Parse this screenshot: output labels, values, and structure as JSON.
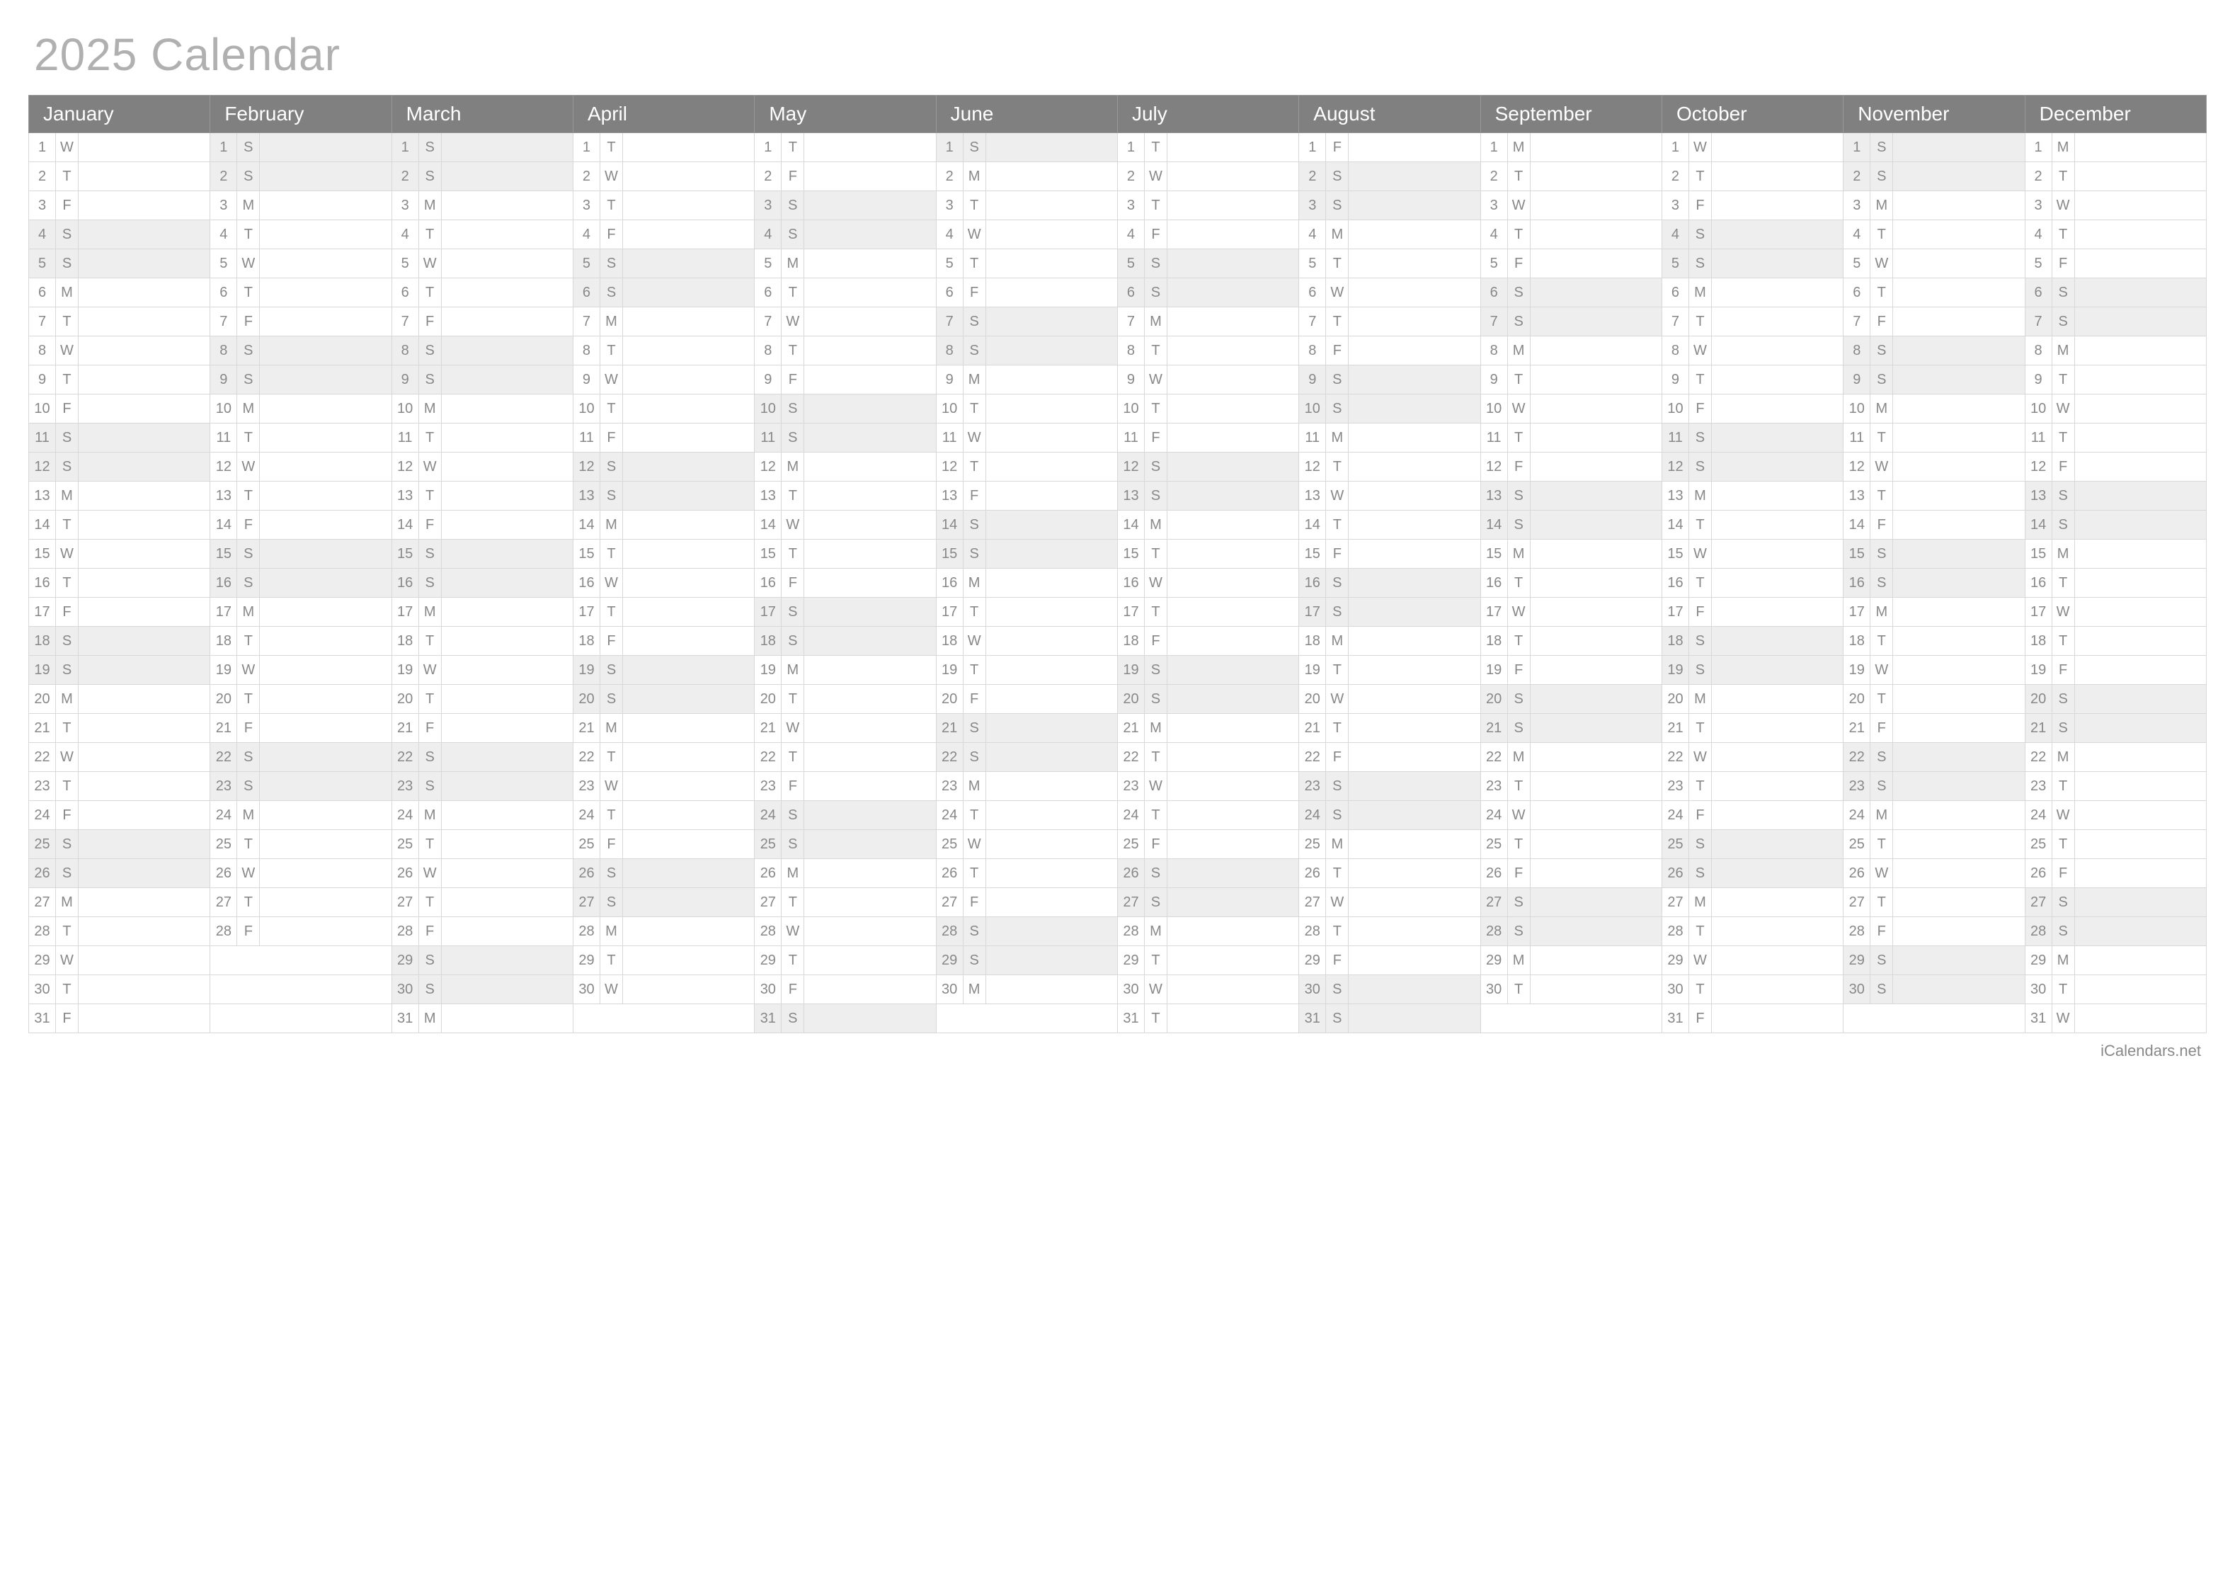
{
  "title": "2025 Calendar",
  "footer": "iCalendars.net",
  "months": [
    "January",
    "February",
    "March",
    "April",
    "May",
    "June",
    "July",
    "August",
    "September",
    "October",
    "November",
    "December"
  ],
  "days_in_month": [
    31,
    28,
    31,
    30,
    31,
    30,
    31,
    31,
    30,
    31,
    30,
    31
  ],
  "start_dow": [
    3,
    6,
    6,
    2,
    4,
    0,
    2,
    5,
    1,
    3,
    6,
    1
  ],
  "dow_labels": [
    "S",
    "M",
    "T",
    "W",
    "T",
    "F",
    "S"
  ],
  "weekend_dows": [
    0,
    6
  ],
  "max_rows": 31
}
